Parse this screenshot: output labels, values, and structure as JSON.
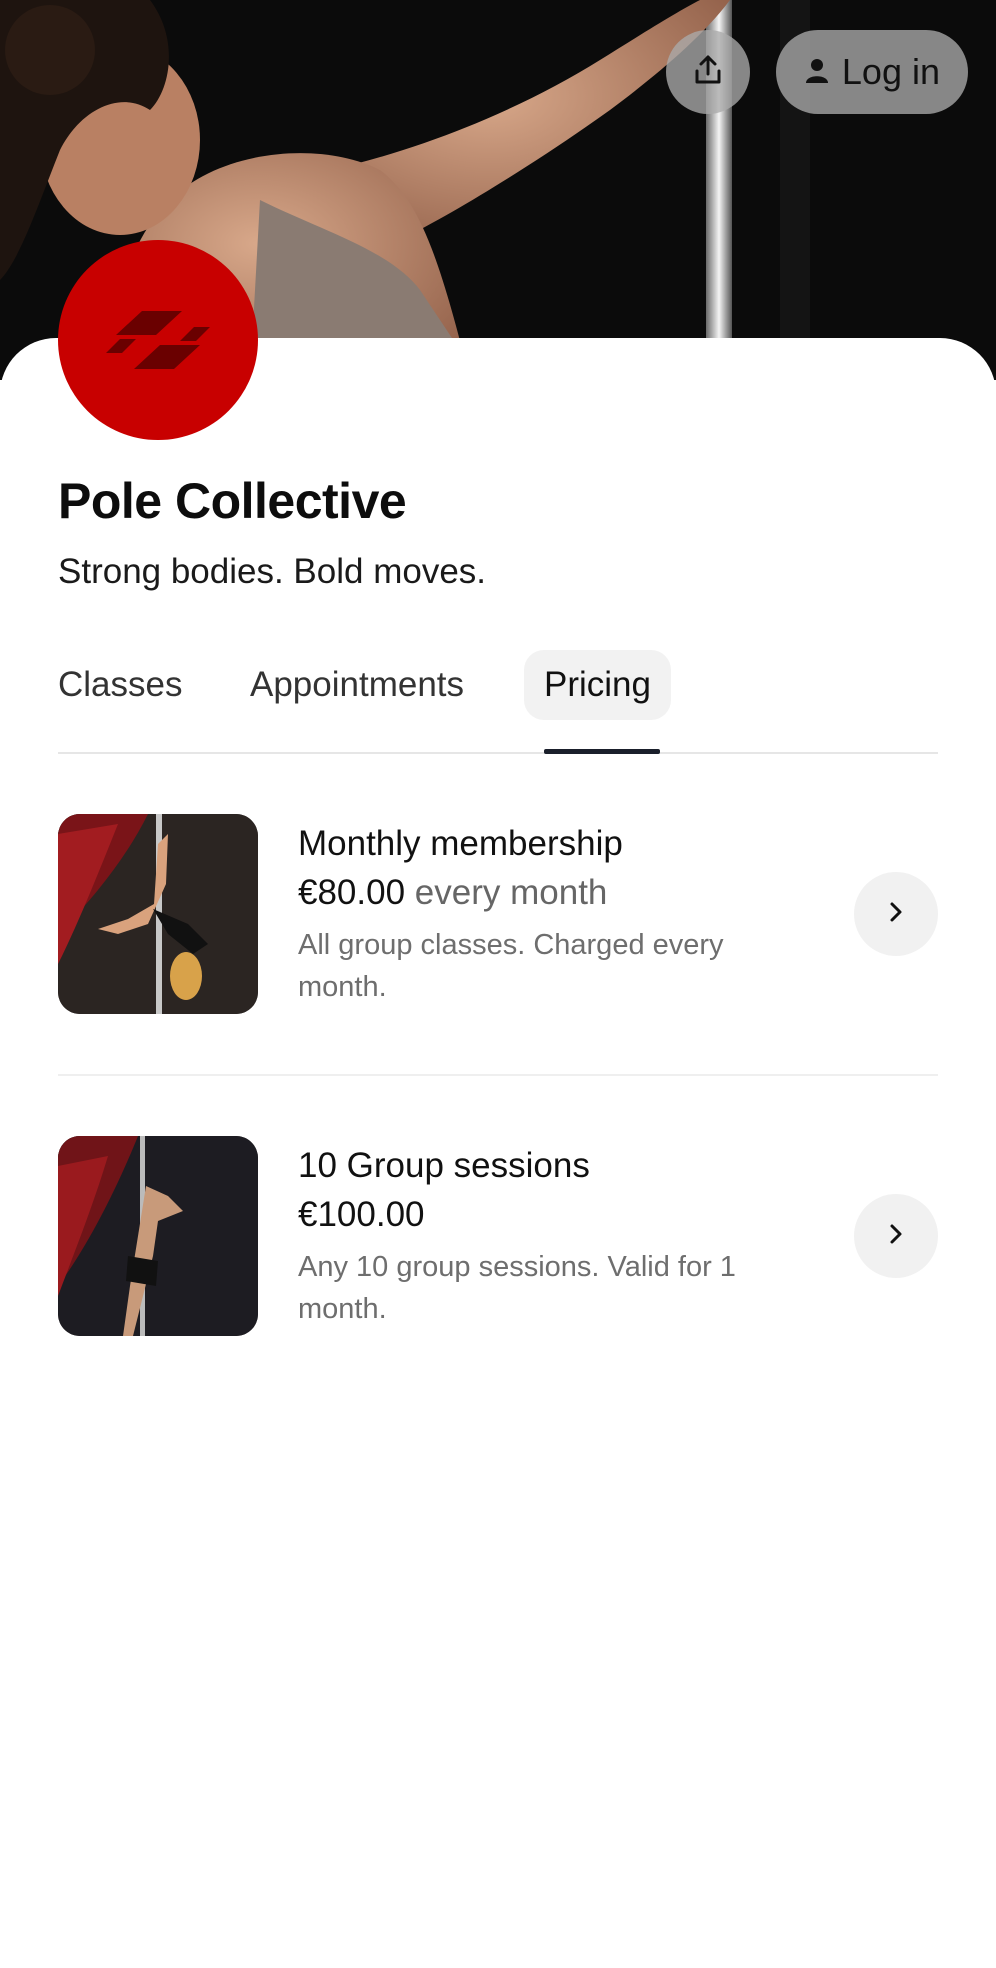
{
  "header": {
    "share_icon": "share-icon",
    "login_label": "Log in",
    "login_icon": "person-icon"
  },
  "studio": {
    "name": "Pole Collective",
    "tagline": "Strong bodies. Bold moves.",
    "brand_color": "#c80000"
  },
  "tabs": [
    {
      "label": "Classes"
    },
    {
      "label": "Appointments"
    },
    {
      "label": "Pricing",
      "active": true
    }
  ],
  "pricing": [
    {
      "title": "Monthly membership",
      "price": "€80.00",
      "period": "every month",
      "description": "All group classes. Charged every month."
    },
    {
      "title": "10 Group sessions",
      "price": "€100.00",
      "period": "",
      "description": "Any 10 group sessions. Valid for 1 month."
    }
  ]
}
